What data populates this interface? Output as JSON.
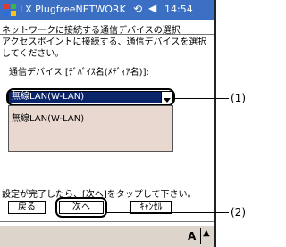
{
  "titlebar": {
    "app_title": "LX PlugfreeNETWORK",
    "clock": "14:54",
    "sync_icon": "⟲",
    "speaker_icon": "◀"
  },
  "dialog": {
    "subtitle": "ネットワークに接続する通信デバイスの選択",
    "description": "アクセスポイントに接続する、通信デバイスを選択してください。",
    "device_label": "通信デバイス [ﾃﾞﾊﾞｲｽ名(ﾒﾃﾞｨｱ名)]:",
    "selected_device": "無線LAN(W-LAN)",
    "list_items": [
      "無線LAN(W-LAN)"
    ],
    "instruction": "設定が完了したら、[次へ]をタップして下さい。",
    "back_label": "戻る",
    "next_label": "次へ",
    "cancel_label": "ｷｬﾝｾﾙ"
  },
  "bottombar": {
    "input_label": "A",
    "up_arrow": "▲"
  },
  "callouts": [
    "(1)",
    "(2)"
  ],
  "colors": {
    "titlebar": "#3a6fc4",
    "selection": "#0a246a",
    "list_bg": "#e8d8d0",
    "bottombar": "#ddd5cc"
  }
}
